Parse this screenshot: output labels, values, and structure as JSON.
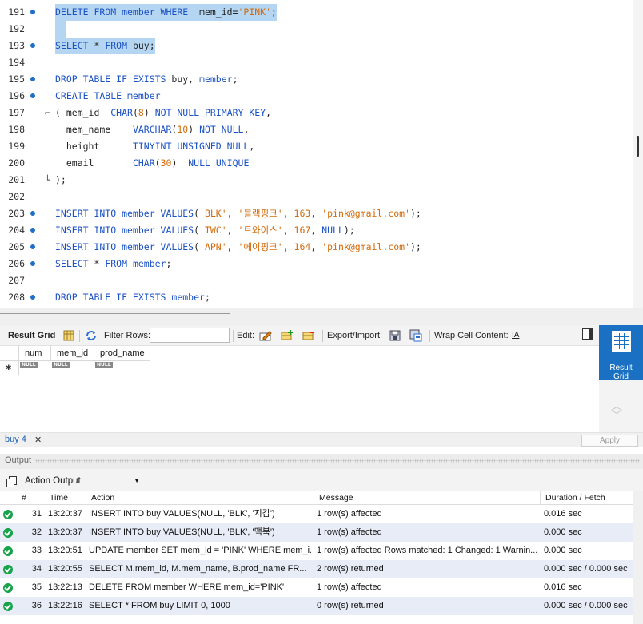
{
  "editor": {
    "lines": [
      {
        "n": "191",
        "dot": true,
        "fold": "",
        "parts": [
          [
            "kw",
            "DELETE FROM member WHERE  "
          ],
          [
            "plain",
            "mem_id="
          ],
          [
            "str",
            "'PINK'"
          ],
          [
            "plain",
            ";"
          ]
        ],
        "selected": true
      },
      {
        "n": "192",
        "dot": false,
        "fold": "",
        "parts": [
          [
            "plain",
            "  "
          ]
        ],
        "selected": true
      },
      {
        "n": "193",
        "dot": true,
        "fold": "",
        "parts": [
          [
            "kw",
            "SELECT"
          ],
          [
            "plain",
            " * "
          ],
          [
            "kw",
            "FROM"
          ],
          [
            "plain",
            " buy;"
          ]
        ],
        "selected": true
      },
      {
        "n": "194",
        "dot": false,
        "fold": "",
        "parts": [],
        "selected": false
      },
      {
        "n": "195",
        "dot": true,
        "fold": "",
        "parts": [
          [
            "kw",
            "DROP TABLE IF EXISTS"
          ],
          [
            "plain",
            " buy, "
          ],
          [
            "kw",
            "member"
          ],
          [
            "plain",
            ";"
          ]
        ],
        "selected": false
      },
      {
        "n": "196",
        "dot": true,
        "fold": "",
        "parts": [
          [
            "kw",
            "CREATE TABLE member"
          ]
        ],
        "selected": false
      },
      {
        "n": "197",
        "dot": false,
        "fold": "⌐",
        "parts": [
          [
            "plain",
            "( mem_id  "
          ],
          [
            "kw",
            "CHAR"
          ],
          [
            "plain",
            "("
          ],
          [
            "num",
            "8"
          ],
          [
            "plain",
            ") "
          ],
          [
            "kw",
            "NOT NULL PRIMARY KEY"
          ],
          [
            "plain",
            ","
          ]
        ],
        "selected": false
      },
      {
        "n": "198",
        "dot": false,
        "fold": "",
        "parts": [
          [
            "plain",
            "  mem_name    "
          ],
          [
            "kw",
            "VARCHAR"
          ],
          [
            "plain",
            "("
          ],
          [
            "num",
            "10"
          ],
          [
            "plain",
            ") "
          ],
          [
            "kw",
            "NOT NULL"
          ],
          [
            "plain",
            ","
          ]
        ],
        "selected": false
      },
      {
        "n": "199",
        "dot": false,
        "fold": "",
        "parts": [
          [
            "plain",
            "  height      "
          ],
          [
            "kw",
            "TINYINT UNSIGNED NULL"
          ],
          [
            "plain",
            ","
          ]
        ],
        "selected": false
      },
      {
        "n": "200",
        "dot": false,
        "fold": "",
        "parts": [
          [
            "plain",
            "  email       "
          ],
          [
            "kw",
            "CHAR"
          ],
          [
            "plain",
            "("
          ],
          [
            "num",
            "30"
          ],
          [
            "plain",
            ")  "
          ],
          [
            "kw",
            "NULL UNIQUE"
          ]
        ],
        "selected": false
      },
      {
        "n": "201",
        "dot": false,
        "fold": "└",
        "parts": [
          [
            "plain",
            ");"
          ]
        ],
        "selected": false
      },
      {
        "n": "202",
        "dot": false,
        "fold": "",
        "parts": [],
        "selected": false
      },
      {
        "n": "203",
        "dot": true,
        "fold": "",
        "parts": [
          [
            "kw",
            "INSERT INTO member VALUES"
          ],
          [
            "plain",
            "("
          ],
          [
            "str",
            "'BLK'"
          ],
          [
            "plain",
            ", "
          ],
          [
            "str",
            "'블랙핑크'"
          ],
          [
            "plain",
            ", "
          ],
          [
            "num",
            "163"
          ],
          [
            "plain",
            ", "
          ],
          [
            "str",
            "'pink@gmail.com'"
          ],
          [
            "plain",
            ");"
          ]
        ],
        "selected": false
      },
      {
        "n": "204",
        "dot": true,
        "fold": "",
        "parts": [
          [
            "kw",
            "INSERT INTO member VALUES"
          ],
          [
            "plain",
            "("
          ],
          [
            "str",
            "'TWC'"
          ],
          [
            "plain",
            ", "
          ],
          [
            "str",
            "'트와이스'"
          ],
          [
            "plain",
            ", "
          ],
          [
            "num",
            "167"
          ],
          [
            "plain",
            ", "
          ],
          [
            "kw",
            "NULL"
          ],
          [
            "plain",
            ");"
          ]
        ],
        "selected": false
      },
      {
        "n": "205",
        "dot": true,
        "fold": "",
        "parts": [
          [
            "kw",
            "INSERT INTO member VALUES"
          ],
          [
            "plain",
            "("
          ],
          [
            "str",
            "'APN'"
          ],
          [
            "plain",
            ", "
          ],
          [
            "str",
            "'에이핑크'"
          ],
          [
            "plain",
            ", "
          ],
          [
            "num",
            "164"
          ],
          [
            "plain",
            ", "
          ],
          [
            "str",
            "'pink@gmail.com'"
          ],
          [
            "plain",
            ");"
          ]
        ],
        "selected": false
      },
      {
        "n": "206",
        "dot": true,
        "fold": "",
        "parts": [
          [
            "kw",
            "SELECT"
          ],
          [
            "plain",
            " * "
          ],
          [
            "kw",
            "FROM member"
          ],
          [
            "plain",
            ";"
          ]
        ],
        "selected": false
      },
      {
        "n": "207",
        "dot": false,
        "fold": "",
        "parts": [],
        "selected": false
      },
      {
        "n": "208",
        "dot": true,
        "fold": "",
        "parts": [
          [
            "kw",
            "DROP TABLE IF EXISTS member"
          ],
          [
            "plain",
            ";"
          ]
        ],
        "selected": false
      }
    ]
  },
  "result_toolbar": {
    "result_grid": "Result Grid",
    "filter_rows": "Filter Rows:",
    "filter_value": "",
    "edit": "Edit:",
    "export_import": "Export/Import:",
    "wrap": "Wrap Cell Content:",
    "wrap_icon": "IA"
  },
  "side_panel": {
    "label_line1": "Result",
    "label_line2": "Grid"
  },
  "grid": {
    "columns": [
      "num",
      "mem_id",
      "prod_name"
    ],
    "new_row_marker": "✱",
    "null_label": "NULL"
  },
  "tabs": {
    "active": "buy 4",
    "close": "✕",
    "apply": "Apply"
  },
  "output": {
    "title": "Output",
    "mode": "Action Output",
    "columns": [
      "#",
      "Time",
      "Action",
      "Message",
      "Duration / Fetch"
    ],
    "rows": [
      {
        "num": "31",
        "time": "13:20:37",
        "action": "INSERT INTO buy VALUES(NULL, 'BLK', '지갑')",
        "message": "1 row(s) affected",
        "duration": "0.016 sec"
      },
      {
        "num": "32",
        "time": "13:20:37",
        "action": "INSERT INTO buy VALUES(NULL, 'BLK', '맥북')",
        "message": "1 row(s) affected",
        "duration": "0.000 sec"
      },
      {
        "num": "33",
        "time": "13:20:51",
        "action": "UPDATE member SET mem_id = 'PINK' WHERE mem_i...",
        "message": "1 row(s) affected Rows matched: 1  Changed: 1  Warnin...",
        "duration": "0.000 sec"
      },
      {
        "num": "34",
        "time": "13:20:55",
        "action": "SELECT M.mem_id, M.mem_name, B.prod_name     FR...",
        "message": "2 row(s) returned",
        "duration": "0.000 sec / 0.000 sec"
      },
      {
        "num": "35",
        "time": "13:22:13",
        "action": "DELETE FROM member WHERE  mem_id='PINK'",
        "message": "1 row(s) affected",
        "duration": "0.016 sec"
      },
      {
        "num": "36",
        "time": "13:22:16",
        "action": "SELECT * FROM buy LIMIT 0, 1000",
        "message": "0 row(s) returned",
        "duration": "0.000 sec / 0.000 sec"
      }
    ]
  }
}
